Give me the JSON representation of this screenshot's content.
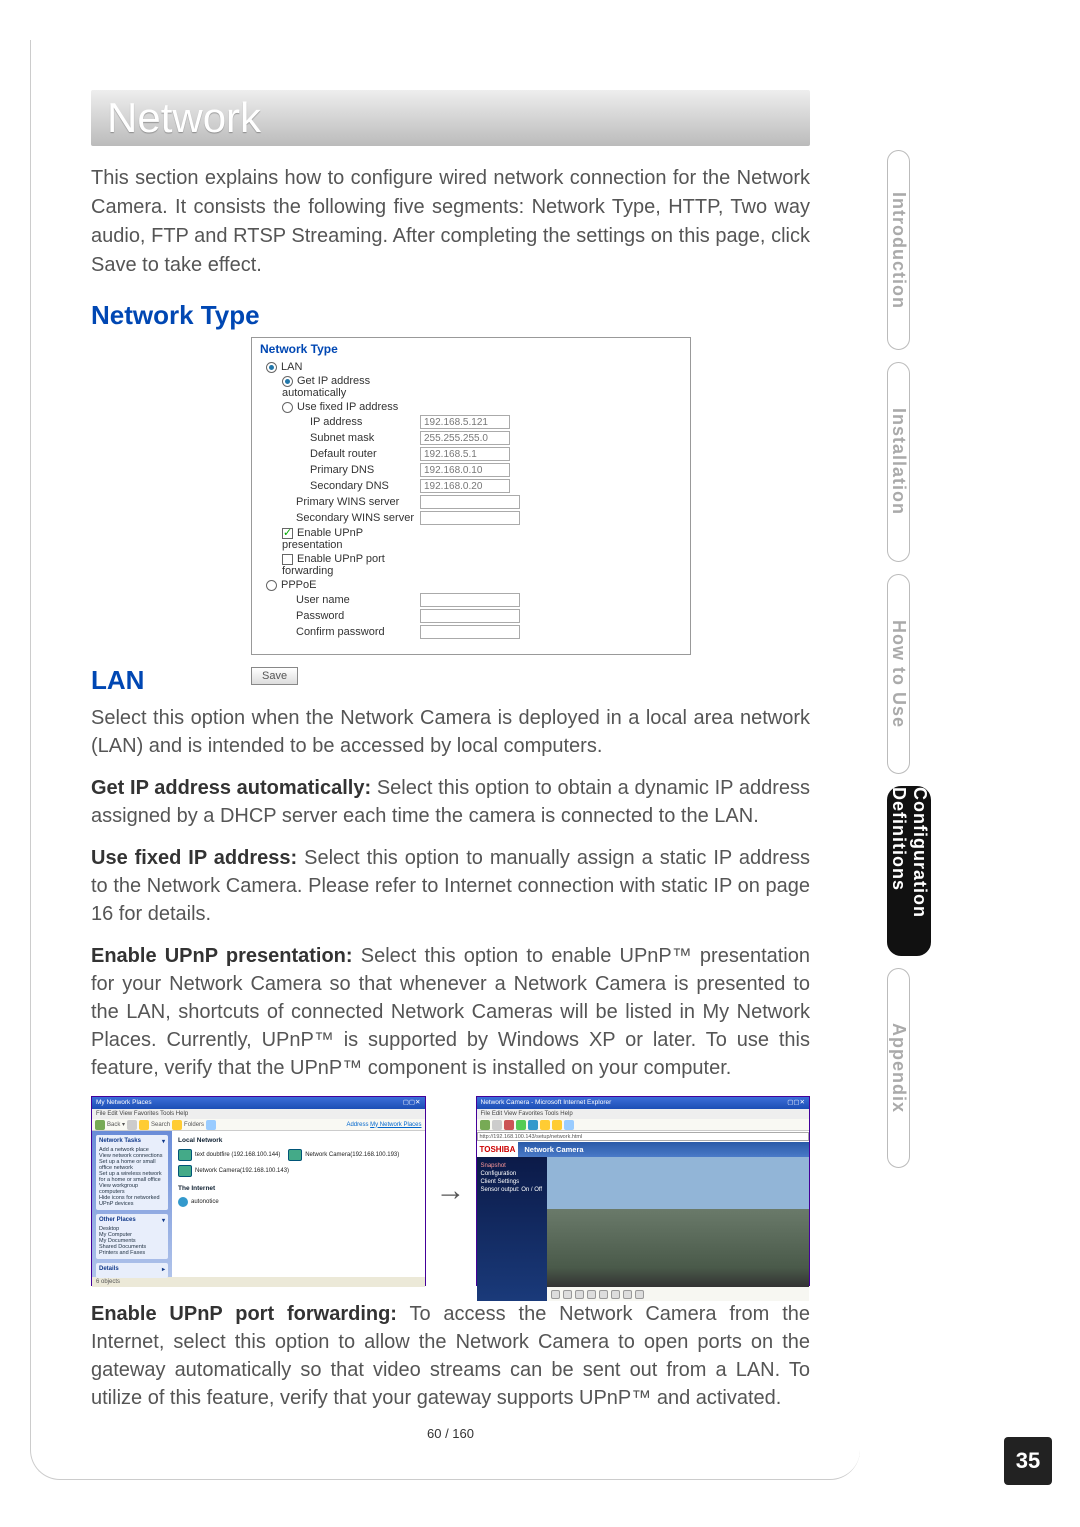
{
  "page": {
    "title": "Network",
    "intro": "This section explains how to configure wired network connection for the Network Camera. It consists the following five segments: Network Type, HTTP, Two way audio, FTP and RTSP Streaming. After completing the settings on this page, click Save to take effect.",
    "pager": "60 / 160",
    "page_number": "35"
  },
  "h_network_type": "Network Type",
  "fig": {
    "head": "Network Type",
    "lan": "LAN",
    "get_auto": "Get IP address automatically",
    "use_fixed": "Use fixed IP address",
    "ip_label": "IP address",
    "ip_val": "192.168.5.121",
    "sub_label": "Subnet mask",
    "sub_val": "255.255.255.0",
    "rtr_label": "Default router",
    "rtr_val": "192.168.5.1",
    "pdns_label": "Primary DNS",
    "pdns_val": "192.168.0.10",
    "sdns_label": "Secondary DNS",
    "sdns_val": "192.168.0.20",
    "pwins_label": "Primary WINS server",
    "swins_label": "Secondary WINS server",
    "upnp_pres": "Enable UPnP presentation",
    "upnp_fwd": "Enable UPnP port forwarding",
    "pppoe": "PPPoE",
    "user": "User name",
    "pass": "Password",
    "confirm": "Confirm password",
    "save": "Save"
  },
  "h_lan": "LAN",
  "lan_para": "Select this option when the Network Camera is deployed in a local area network (LAN) and is intended to be accessed by local computers.",
  "get_ip_b": "Get IP address automatically:",
  "get_ip_t": " Select this option to obtain a dynamic IP address assigned by a DHCP server each time the camera is connected to the LAN.",
  "fixed_b": "Use fixed IP address:",
  "fixed_t": " Select this option to manually assign a static IP address to the Network Camera. Please refer to Internet connection with static IP on page 16 for details.",
  "upnp_pres_b": "Enable UPnP presentation:",
  "upnp_pres_t": " Select this option to enable UPnP™ presentation for your Network Camera so that whenever a Network Camera is presented to the LAN, shortcuts of connected Network Cameras will be listed in My Network Places. Currently, UPnP™ is supported by Windows XP or later. To use this feature, verify that the UPnP™ component is installed on your computer.",
  "upnp_fwd_b": "Enable UPnP port forwarding:",
  "upnp_fwd_t": " To access the Network Camera from the Internet, select this option to allow the Network Camera to open ports on the gateway automatically so that video streams can be sent out from a LAN. To utilize of this feature, verify that your gateway supports UPnP™ and activated.",
  "shots": {
    "left_title": "My Network Places",
    "left_menu": "File   Edit   View   Favorites   Tools   Help",
    "left_tasks_h": "Network Tasks",
    "left_tasks": [
      "Add a network place",
      "View network connections",
      "Set up a home or small office network",
      "Set up a wireless network for a home or small office",
      "View workgroup computers",
      "Hide icons for networked UPnP devices"
    ],
    "left_other_h": "Other Places",
    "left_other": [
      "Desktop",
      "My Computer",
      "My Documents",
      "Shared Documents",
      "Printers and Faxes"
    ],
    "left_details_h": "Details",
    "left_sect1": "Local Network",
    "left_item1": "text doubtfire (192.168.100.144)",
    "left_item2": "Network Camera(192.168.100.193)",
    "left_item3": "Network Camera(192.168.100.143)",
    "left_sect2": "The Internet",
    "left_item4": "autonotice",
    "left_status": "6 objects",
    "left_addr_lbl": "Address",
    "left_addr_val": "My Network Places",
    "right_title": "Network Camera - Microsoft Internet Explorer",
    "right_menu": "File   Edit   View   Favorites   Tools   Help",
    "right_addr": "http://192.168.100.143/setup/network.html",
    "right_brand": "TOSHIBA",
    "right_head": "Network Camera",
    "right_nav": [
      "Snapshot",
      "Configuration",
      "Client Settings",
      "Sensor output: On / Off"
    ]
  },
  "side_tabs": {
    "intro": "Introduction",
    "install": "Installation",
    "howto": "How to Use",
    "config": "Configuration Definitions",
    "appendix": "Appendix"
  }
}
